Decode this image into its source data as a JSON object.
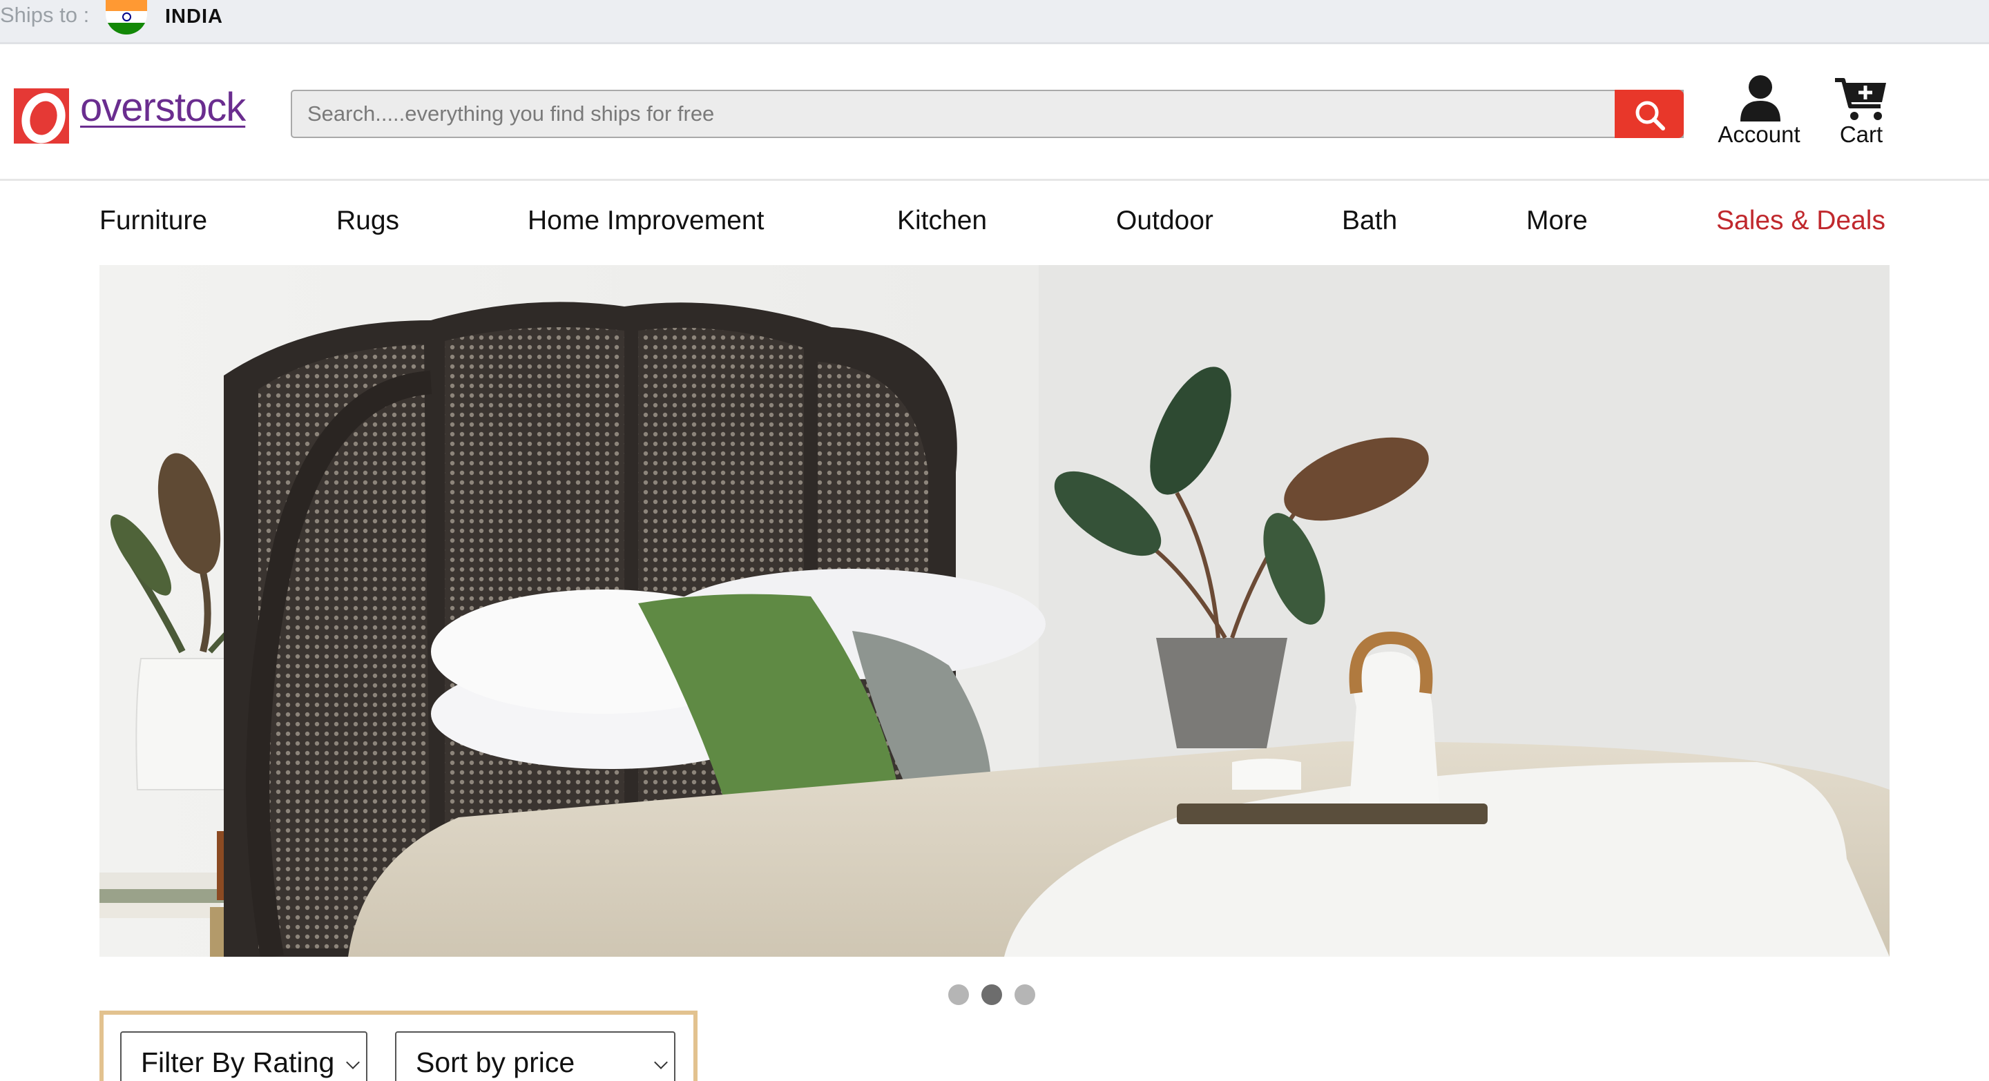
{
  "shipbar": {
    "label": "Ships to :",
    "country": "INDIA"
  },
  "header": {
    "logo_text": "overstock",
    "search_placeholder": "Search.....everything you find ships for free",
    "account_label": "Account",
    "cart_label": "Cart"
  },
  "nav": {
    "items": [
      "Furniture",
      "Rugs",
      "Home Improvement",
      "Kitchen",
      "Outdoor",
      "Bath",
      "More",
      "Sales & Deals"
    ]
  },
  "carousel": {
    "slide_count": 3,
    "active_index": 1
  },
  "filters": {
    "rating_label": "Filter By Rating",
    "price_label": "Sort by price"
  },
  "colors": {
    "brand_red": "#e8372a",
    "logo_purple": "#6a2d8f",
    "sale_red": "#c0282d",
    "filter_border": "#e2c28f"
  }
}
